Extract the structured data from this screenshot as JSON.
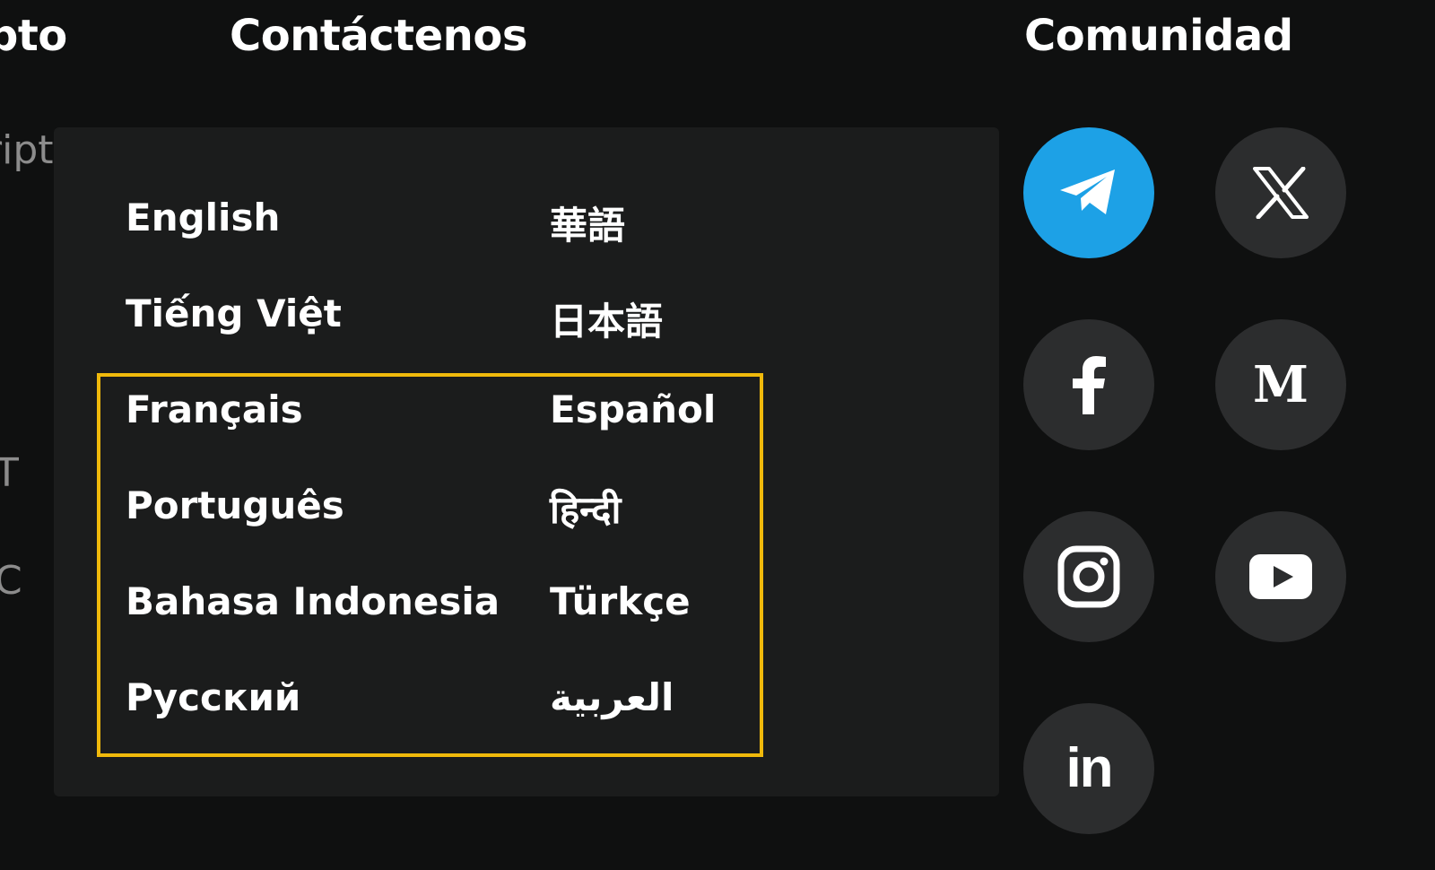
{
  "headings": {
    "crypto_partial": "pto",
    "contact": "Contáctenos",
    "community": "Comunidad"
  },
  "peek_text": [
    "ript",
    "T",
    "C"
  ],
  "language_menu": {
    "languages": [
      "English",
      "華語",
      "Tiếng Việt",
      "日本語",
      "Français",
      "Español",
      "Português",
      "हिन्दी",
      "Bahasa Indonesia",
      "Türkçe",
      "Русский",
      "العربية"
    ],
    "highlight_color": "#f0b90b"
  },
  "social": {
    "active_color": "#1da1e6",
    "icons": [
      "telegram-icon",
      "x-icon",
      "facebook-icon",
      "medium-icon",
      "instagram-icon",
      "youtube-icon",
      "linkedin-icon"
    ],
    "medium_glyph": "M",
    "linkedin_glyph": "in"
  }
}
